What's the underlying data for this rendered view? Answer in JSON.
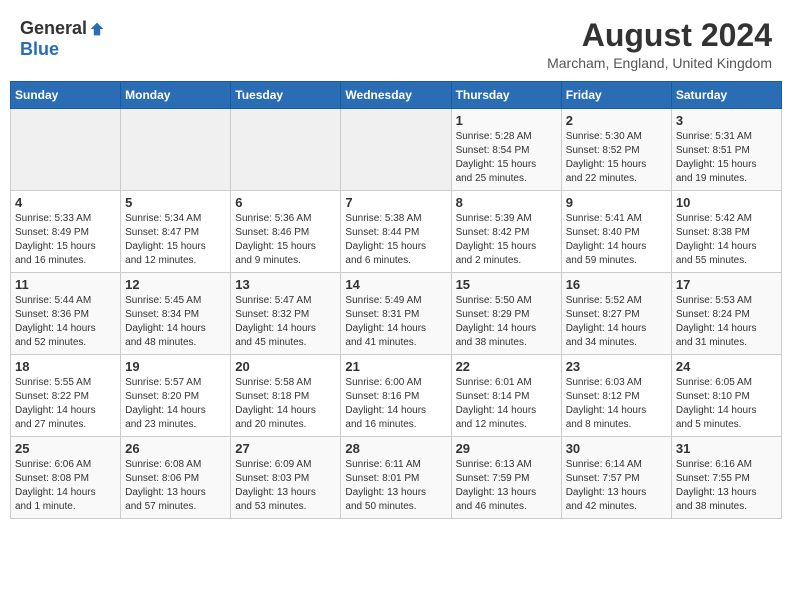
{
  "header": {
    "logo_general": "General",
    "logo_blue": "Blue",
    "month_year": "August 2024",
    "location": "Marcham, England, United Kingdom"
  },
  "calendar": {
    "days_of_week": [
      "Sunday",
      "Monday",
      "Tuesday",
      "Wednesday",
      "Thursday",
      "Friday",
      "Saturday"
    ],
    "weeks": [
      [
        {
          "day": "",
          "info": ""
        },
        {
          "day": "",
          "info": ""
        },
        {
          "day": "",
          "info": ""
        },
        {
          "day": "",
          "info": ""
        },
        {
          "day": "1",
          "info": "Sunrise: 5:28 AM\nSunset: 8:54 PM\nDaylight: 15 hours\nand 25 minutes."
        },
        {
          "day": "2",
          "info": "Sunrise: 5:30 AM\nSunset: 8:52 PM\nDaylight: 15 hours\nand 22 minutes."
        },
        {
          "day": "3",
          "info": "Sunrise: 5:31 AM\nSunset: 8:51 PM\nDaylight: 15 hours\nand 19 minutes."
        }
      ],
      [
        {
          "day": "4",
          "info": "Sunrise: 5:33 AM\nSunset: 8:49 PM\nDaylight: 15 hours\nand 16 minutes."
        },
        {
          "day": "5",
          "info": "Sunrise: 5:34 AM\nSunset: 8:47 PM\nDaylight: 15 hours\nand 12 minutes."
        },
        {
          "day": "6",
          "info": "Sunrise: 5:36 AM\nSunset: 8:46 PM\nDaylight: 15 hours\nand 9 minutes."
        },
        {
          "day": "7",
          "info": "Sunrise: 5:38 AM\nSunset: 8:44 PM\nDaylight: 15 hours\nand 6 minutes."
        },
        {
          "day": "8",
          "info": "Sunrise: 5:39 AM\nSunset: 8:42 PM\nDaylight: 15 hours\nand 2 minutes."
        },
        {
          "day": "9",
          "info": "Sunrise: 5:41 AM\nSunset: 8:40 PM\nDaylight: 14 hours\nand 59 minutes."
        },
        {
          "day": "10",
          "info": "Sunrise: 5:42 AM\nSunset: 8:38 PM\nDaylight: 14 hours\nand 55 minutes."
        }
      ],
      [
        {
          "day": "11",
          "info": "Sunrise: 5:44 AM\nSunset: 8:36 PM\nDaylight: 14 hours\nand 52 minutes."
        },
        {
          "day": "12",
          "info": "Sunrise: 5:45 AM\nSunset: 8:34 PM\nDaylight: 14 hours\nand 48 minutes."
        },
        {
          "day": "13",
          "info": "Sunrise: 5:47 AM\nSunset: 8:32 PM\nDaylight: 14 hours\nand 45 minutes."
        },
        {
          "day": "14",
          "info": "Sunrise: 5:49 AM\nSunset: 8:31 PM\nDaylight: 14 hours\nand 41 minutes."
        },
        {
          "day": "15",
          "info": "Sunrise: 5:50 AM\nSunset: 8:29 PM\nDaylight: 14 hours\nand 38 minutes."
        },
        {
          "day": "16",
          "info": "Sunrise: 5:52 AM\nSunset: 8:27 PM\nDaylight: 14 hours\nand 34 minutes."
        },
        {
          "day": "17",
          "info": "Sunrise: 5:53 AM\nSunset: 8:24 PM\nDaylight: 14 hours\nand 31 minutes."
        }
      ],
      [
        {
          "day": "18",
          "info": "Sunrise: 5:55 AM\nSunset: 8:22 PM\nDaylight: 14 hours\nand 27 minutes."
        },
        {
          "day": "19",
          "info": "Sunrise: 5:57 AM\nSunset: 8:20 PM\nDaylight: 14 hours\nand 23 minutes."
        },
        {
          "day": "20",
          "info": "Sunrise: 5:58 AM\nSunset: 8:18 PM\nDaylight: 14 hours\nand 20 minutes."
        },
        {
          "day": "21",
          "info": "Sunrise: 6:00 AM\nSunset: 8:16 PM\nDaylight: 14 hours\nand 16 minutes."
        },
        {
          "day": "22",
          "info": "Sunrise: 6:01 AM\nSunset: 8:14 PM\nDaylight: 14 hours\nand 12 minutes."
        },
        {
          "day": "23",
          "info": "Sunrise: 6:03 AM\nSunset: 8:12 PM\nDaylight: 14 hours\nand 8 minutes."
        },
        {
          "day": "24",
          "info": "Sunrise: 6:05 AM\nSunset: 8:10 PM\nDaylight: 14 hours\nand 5 minutes."
        }
      ],
      [
        {
          "day": "25",
          "info": "Sunrise: 6:06 AM\nSunset: 8:08 PM\nDaylight: 14 hours\nand 1 minute."
        },
        {
          "day": "26",
          "info": "Sunrise: 6:08 AM\nSunset: 8:06 PM\nDaylight: 13 hours\nand 57 minutes."
        },
        {
          "day": "27",
          "info": "Sunrise: 6:09 AM\nSunset: 8:03 PM\nDaylight: 13 hours\nand 53 minutes."
        },
        {
          "day": "28",
          "info": "Sunrise: 6:11 AM\nSunset: 8:01 PM\nDaylight: 13 hours\nand 50 minutes."
        },
        {
          "day": "29",
          "info": "Sunrise: 6:13 AM\nSunset: 7:59 PM\nDaylight: 13 hours\nand 46 minutes."
        },
        {
          "day": "30",
          "info": "Sunrise: 6:14 AM\nSunset: 7:57 PM\nDaylight: 13 hours\nand 42 minutes."
        },
        {
          "day": "31",
          "info": "Sunrise: 6:16 AM\nSunset: 7:55 PM\nDaylight: 13 hours\nand 38 minutes."
        }
      ]
    ]
  }
}
